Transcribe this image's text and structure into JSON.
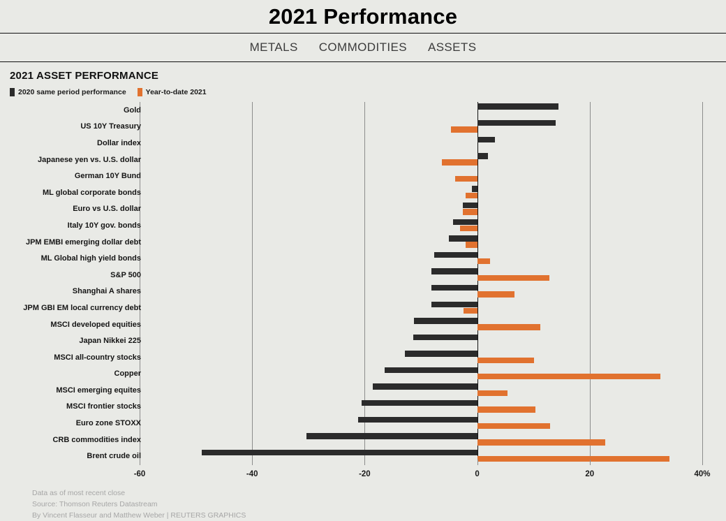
{
  "header": {
    "title": "2021 Performance",
    "nav": [
      {
        "label": "METALS"
      },
      {
        "label": "COMMODITIES"
      },
      {
        "label": "ASSETS"
      }
    ]
  },
  "chart_header": {
    "title": "2021 ASSET PERFORMANCE",
    "legend": [
      {
        "label": "2020 same period performance",
        "color": "#2b2b2b"
      },
      {
        "label": "Year-to-date 2021",
        "color": "#e1722f"
      }
    ]
  },
  "footer": {
    "lines": [
      "Data as of most recent close",
      "Source: Thomson Reuters Datastream",
      "By Vincent Flasseur and Matthew Weber | REUTERS GRAPHICS"
    ]
  },
  "chart_data": {
    "type": "bar",
    "orientation": "horizontal",
    "title": "2021 ASSET PERFORMANCE",
    "xlabel": "",
    "ylabel": "",
    "xlim": [
      -60,
      40
    ],
    "xticks": [
      -60,
      -40,
      -20,
      0,
      20,
      40
    ],
    "xticklabels": [
      "-60",
      "-40",
      "-20",
      "0",
      "20",
      "40%"
    ],
    "grid": true,
    "legend_position": "top-left",
    "categories": [
      "Gold",
      "US 10Y Treasury",
      "Dollar index",
      "Japanese yen vs. U.S. dollar",
      "German 10Y Bund",
      "ML global corporate bonds",
      "Euro vs U.S. dollar",
      "Italy 10Y gov. bonds",
      "JPM EMBI emerging dollar debt",
      "ML Global high yield bonds",
      "S&P 500",
      "Shanghai A shares",
      "JPM GBI EM local currency debt",
      "MSCI developed equities",
      "Japan Nikkei 225",
      "MSCI all-country stocks",
      "Copper",
      "MSCI emerging equites",
      "MSCI frontier stocks",
      "Euro zone STOXX",
      "CRB commodities index",
      "Brent crude oil"
    ],
    "series": [
      {
        "name": "2020 same period performance",
        "color": "#2b2b2b",
        "values": [
          14.5,
          14.0,
          3.2,
          1.9,
          0.0,
          -0.9,
          -2.6,
          -4.3,
          -5.0,
          -7.6,
          -8.1,
          -8.1,
          -8.2,
          -11.3,
          -11.4,
          -12.8,
          -16.5,
          -18.5,
          -20.5,
          -21.2,
          -30.4,
          -49.0
        ]
      },
      {
        "name": "Year-to-date 2021",
        "color": "#e1722f",
        "values": [
          0.0,
          -4.7,
          0.0,
          -6.3,
          -3.9,
          -2.0,
          -2.6,
          -3.0,
          -2.0,
          2.3,
          12.8,
          6.6,
          -2.4,
          11.2,
          0.0,
          10.1,
          32.5,
          5.4,
          10.3,
          13.0,
          22.7,
          34.2
        ]
      }
    ]
  }
}
